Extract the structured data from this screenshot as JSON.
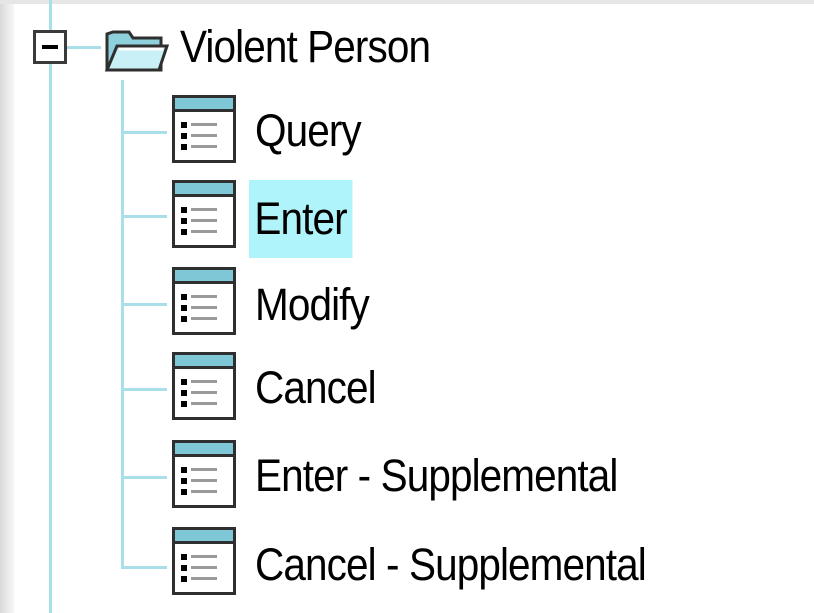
{
  "tree": {
    "root": {
      "label": "Violent Person",
      "expanded": true,
      "expander_symbol": "minus",
      "icon": "open-folder-icon",
      "children": [
        {
          "label": "Query",
          "icon": "form-icon",
          "selected": false
        },
        {
          "label": "Enter",
          "icon": "form-icon",
          "selected": true
        },
        {
          "label": "Modify",
          "icon": "form-icon",
          "selected": false
        },
        {
          "label": "Cancel",
          "icon": "form-icon",
          "selected": false
        },
        {
          "label": "Enter - Supplemental",
          "icon": "form-icon",
          "selected": false
        },
        {
          "label": "Cancel - Supplemental",
          "icon": "form-icon",
          "selected": false
        }
      ]
    }
  },
  "colors": {
    "selection_background": "#b0f4fb",
    "tree_line": "#a8dfe9",
    "form_icon_titlebar": "#7fc7d7"
  }
}
